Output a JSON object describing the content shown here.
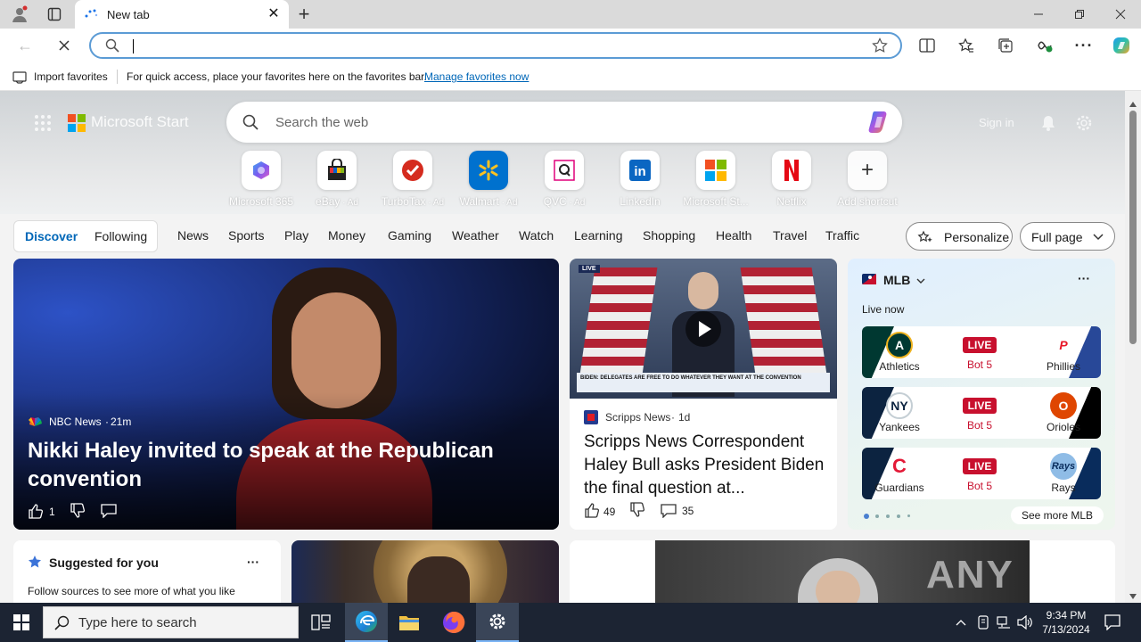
{
  "browser": {
    "tab_title": "New tab",
    "address_value": "",
    "favorites_bar": {
      "import_label": "Import favorites",
      "hint_text": "For quick access, place your favorites here on the favorites bar.",
      "manage_link": "Manage favorites now"
    }
  },
  "header": {
    "brand": "Microsoft Start",
    "search_placeholder": "Search the web",
    "sign_in": "Sign in"
  },
  "shortcuts": [
    {
      "label": "Microsoft 365",
      "ad": ""
    },
    {
      "label": "eBay",
      "ad": " · Ad"
    },
    {
      "label": "TurboTax",
      "ad": " · Ad"
    },
    {
      "label": "Walmart",
      "ad": " · Ad"
    },
    {
      "label": "QVC",
      "ad": " · Ad"
    },
    {
      "label": "LinkedIn",
      "ad": ""
    },
    {
      "label": "Microsoft St...",
      "ad": ""
    },
    {
      "label": "Netflix",
      "ad": ""
    },
    {
      "label": "Add shortcut",
      "ad": ""
    }
  ],
  "nav": {
    "discover": "Discover",
    "following": "Following",
    "items": [
      "News",
      "Sports",
      "Play",
      "Money",
      "Gaming",
      "Weather",
      "Watch",
      "Learning",
      "Shopping",
      "Health",
      "Travel",
      "Traffic"
    ],
    "personalize": "Personalize",
    "layout": "Full page"
  },
  "feature_story": {
    "source": "NBC News",
    "age": "21m",
    "headline": "Nikki Haley invited to speak at the Republican convention",
    "likes": "1"
  },
  "video_story": {
    "source": "Scripps News",
    "age": "1d",
    "headline": "Scripps News Correspondent Haley Bull asks President Biden the final question at...",
    "likes": "49",
    "comments": "35",
    "live_tag": "LIVE",
    "chyron": "BIDEN: DELEGATES ARE FREE TO DO WHATEVER THEY WANT AT THE CONVENTION"
  },
  "mlb": {
    "title": "MLB",
    "live_now": "Live now",
    "games": [
      {
        "home": "Athletics",
        "away": "Phillies",
        "status": "LIVE",
        "inning": "Bot 5"
      },
      {
        "home": "Yankees",
        "away": "Orioles",
        "status": "LIVE",
        "inning": "Bot 5"
      },
      {
        "home": "Guardians",
        "away": "Rays",
        "status": "LIVE",
        "inning": "Bot 5"
      }
    ],
    "see_more": "See more MLB"
  },
  "suggested": {
    "title": "Suggested for you",
    "text": "Follow sources to see more of what you like"
  },
  "watermark": "ANY RUN",
  "taskbar": {
    "search_placeholder": "Type here to search",
    "time": "9:34 PM",
    "date": "7/13/2024"
  },
  "colors": {
    "accent": "#0067b8",
    "live": "#c8102e",
    "taskbar": "#1c2433"
  }
}
